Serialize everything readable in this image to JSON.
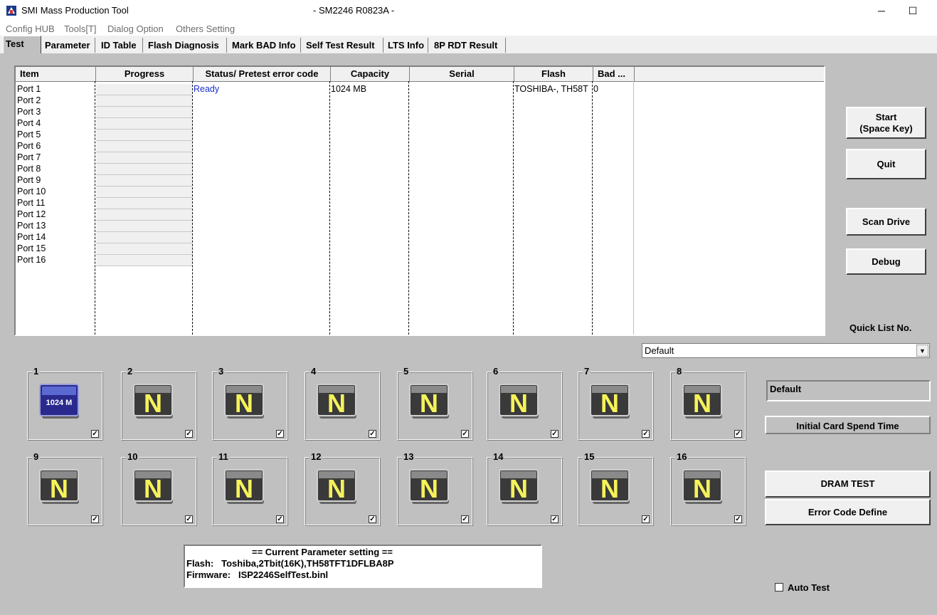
{
  "window": {
    "title": "SMI Mass Production Tool",
    "subtitle": "- SM2246 R0823A -",
    "minimize": "─",
    "maximize": "☐"
  },
  "menu": [
    "Config HUB",
    "Tools[T]",
    "Dialog Option",
    "Others Setting"
  ],
  "tabs": [
    "Test",
    "Parameter",
    "ID Table",
    "Flash Diagnosis",
    "Mark BAD Info",
    "Self Test Result",
    "LTS Info",
    "8P RDT Result"
  ],
  "grid": {
    "headers": [
      "Item",
      "Progress",
      "Status/ Pretest error code",
      "Capacity",
      "Serial",
      "Flash",
      "Bad ..."
    ],
    "ports": [
      "Port 1",
      "Port 2",
      "Port 3",
      "Port 4",
      "Port 5",
      "Port 6",
      "Port 7",
      "Port 8",
      "Port 9",
      "Port 10",
      "Port 11",
      "Port 12",
      "Port 13",
      "Port 14",
      "Port 15",
      "Port 16"
    ],
    "port1": {
      "status": "Ready",
      "capacity": "1024 MB",
      "flash": "TOSHIBA-, TH58T",
      "bad": "0"
    }
  },
  "buttons": {
    "start_line1": "Start",
    "start_line2": "(Space Key)",
    "quit": "Quit",
    "scan_drive": "Scan Drive",
    "debug": "Debug",
    "dram_test": "DRAM TEST",
    "error_code_define": "Error Code Define"
  },
  "quick_list": {
    "label": "Quick List No.",
    "selected": "Default"
  },
  "default_box": "Default",
  "initial_card_spend_time": "Initial Card Spend Time",
  "slots": [
    {
      "num": "1",
      "icon": "1024 M",
      "active": true
    },
    {
      "num": "2",
      "icon": "N"
    },
    {
      "num": "3",
      "icon": "N"
    },
    {
      "num": "4",
      "icon": "N"
    },
    {
      "num": "5",
      "icon": "N"
    },
    {
      "num": "6",
      "icon": "N"
    },
    {
      "num": "7",
      "icon": "N"
    },
    {
      "num": "8",
      "icon": "N"
    },
    {
      "num": "9",
      "icon": "N"
    },
    {
      "num": "10",
      "icon": "N"
    },
    {
      "num": "11",
      "icon": "N"
    },
    {
      "num": "12",
      "icon": "N"
    },
    {
      "num": "13",
      "icon": "N"
    },
    {
      "num": "14",
      "icon": "N"
    },
    {
      "num": "15",
      "icon": "N"
    },
    {
      "num": "16",
      "icon": "N"
    }
  ],
  "parameter": {
    "heading": "== Current Parameter setting ==",
    "flash_line": "Flash:   Toshiba,2Tbit(16K),TH58TFT1DFLBA8P",
    "firmware_line": "Firmware:   ISP2246SelfTest.binl"
  },
  "auto_test": {
    "label": "Auto Test",
    "checked": false
  }
}
